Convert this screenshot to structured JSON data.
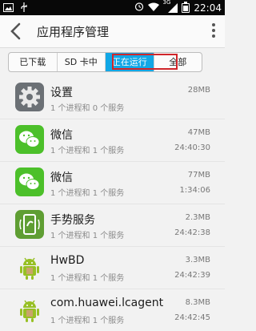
{
  "status_bar": {
    "time": "22:04",
    "network": "3G",
    "battery_level": 0.8,
    "icons": [
      "image-icon",
      "usb-icon",
      "alarm-icon",
      "wifi-icon",
      "signal-icon",
      "battery-icon"
    ]
  },
  "header": {
    "title": "应用程序管理"
  },
  "tabs": [
    {
      "label": "已下载",
      "active": false
    },
    {
      "label": "SD 卡中",
      "active": false
    },
    {
      "label": "正在运行",
      "active": true
    },
    {
      "label": "全部",
      "active": false
    }
  ],
  "apps": [
    {
      "name": "设置",
      "detail": "1 个进程和 0 个服务",
      "size": "28MB",
      "time": "",
      "icon": "settings-icon"
    },
    {
      "name": "微信",
      "detail": "1 个进程和 1 个服务",
      "size": "47MB",
      "time": "24:40:30",
      "icon": "wechat-icon"
    },
    {
      "name": "微信",
      "detail": "1 个进程和 1 个服务",
      "size": "77MB",
      "time": "1:34:06",
      "icon": "wechat-icon"
    },
    {
      "name": "手势服务",
      "detail": "1 个进程和 1 个服务",
      "size": "2.3MB",
      "time": "24:42:38",
      "icon": "gesture-icon"
    },
    {
      "name": "HwBD",
      "detail": "1 个进程和 1 个服务",
      "size": "3.3MB",
      "time": "24:42:39",
      "icon": "android-icon"
    },
    {
      "name": "com.huawei.lcagent",
      "detail": "1 个进程和 1 个服务",
      "size": "8.3MB",
      "time": "24:42:45",
      "icon": "android-icon"
    }
  ],
  "colors": {
    "accent": "#11a7e6",
    "highlight": "#d0262a",
    "wechat": "#4cc02a",
    "android": "#97c024",
    "settings": "#6b7075"
  }
}
